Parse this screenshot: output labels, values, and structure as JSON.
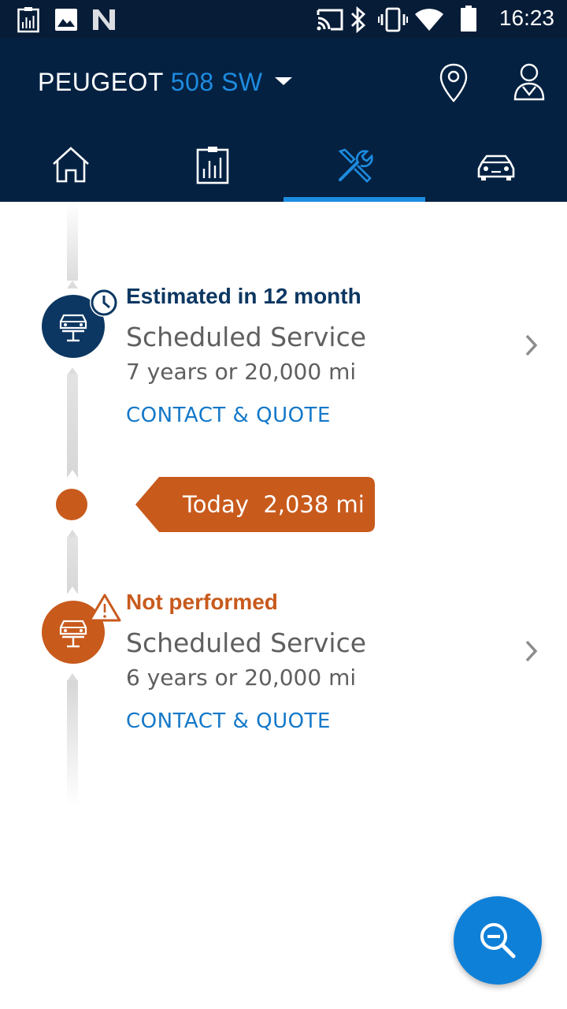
{
  "status_bar": {
    "time": "16:23",
    "icons": [
      "stats-notification-icon",
      "image-notification-icon",
      "n-notification-icon",
      "cast-icon",
      "bluetooth-icon",
      "vibrate-icon",
      "wifi-icon",
      "battery-icon"
    ]
  },
  "header": {
    "make": "PEUGEOT",
    "model": "508 SW",
    "accent_color": "#1d8ce0",
    "background_color": "#042142",
    "tabs": [
      {
        "icon": "home-icon",
        "selected": false
      },
      {
        "icon": "stats-icon",
        "selected": false
      },
      {
        "icon": "tools-icon",
        "selected": true
      },
      {
        "icon": "car-icon",
        "selected": false
      }
    ]
  },
  "timeline": {
    "upcoming": {
      "status": "Estimated in 12 month",
      "service": "Scheduled Service",
      "interval": "7 years or 20,000 mi",
      "action": "CONTACT & QUOTE",
      "color": "#0c3762",
      "badge_icon": "clock-icon"
    },
    "today": {
      "label": "Today",
      "mileage": "2,038 mi",
      "color": "#c85a1c"
    },
    "overdue": {
      "status": "Not performed",
      "service": "Scheduled Service",
      "interval": "6 years or 20,000 mi",
      "action": "CONTACT & QUOTE",
      "color": "#c85a1c",
      "badge_icon": "warning-icon"
    }
  },
  "fab": {
    "icon": "zoom-out-icon"
  }
}
